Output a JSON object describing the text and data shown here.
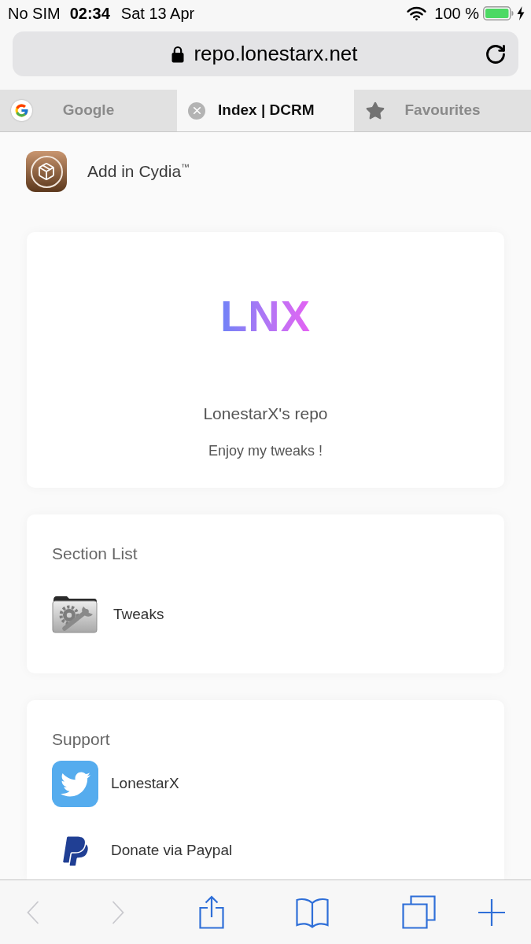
{
  "status_bar": {
    "carrier": "No SIM",
    "time": "02:34",
    "date": "Sat 13 Apr",
    "battery": "100 %",
    "charging": true
  },
  "address_bar": {
    "url": "repo.lonestarx.net",
    "secure": true
  },
  "tabs": [
    {
      "kind": "google",
      "label": "Google",
      "selected": false
    },
    {
      "label": "Index | DCRM",
      "selected": true
    },
    {
      "kind": "favourites",
      "label": "Favourites",
      "selected": false
    }
  ],
  "cydia_link": {
    "label": "Add in Cydia$^{™}$"
  },
  "header_card": {
    "logo": "LNX",
    "title": "LonestarX's repo",
    "subtitle": "Enjoy my tweaks !"
  },
  "sections": {
    "title": "Section List",
    "items": [
      {
        "label": "Tweaks"
      }
    ]
  },
  "support": {
    "title": "Support",
    "items": [
      {
        "kind": "twitter",
        "label": "LonestarX"
      },
      {
        "kind": "paypal",
        "label": "Donate via Paypal"
      }
    ]
  },
  "toolbar": [
    {
      "kind": "back",
      "disabled": true
    },
    {
      "kind": "forward",
      "disabled": true
    },
    {
      "kind": "share",
      "disabled": false
    },
    {
      "kind": "bookmarks",
      "disabled": false
    },
    {
      "kind": "tabs",
      "disabled": false
    },
    {
      "kind": "new-tab",
      "disabled": false
    }
  ]
}
